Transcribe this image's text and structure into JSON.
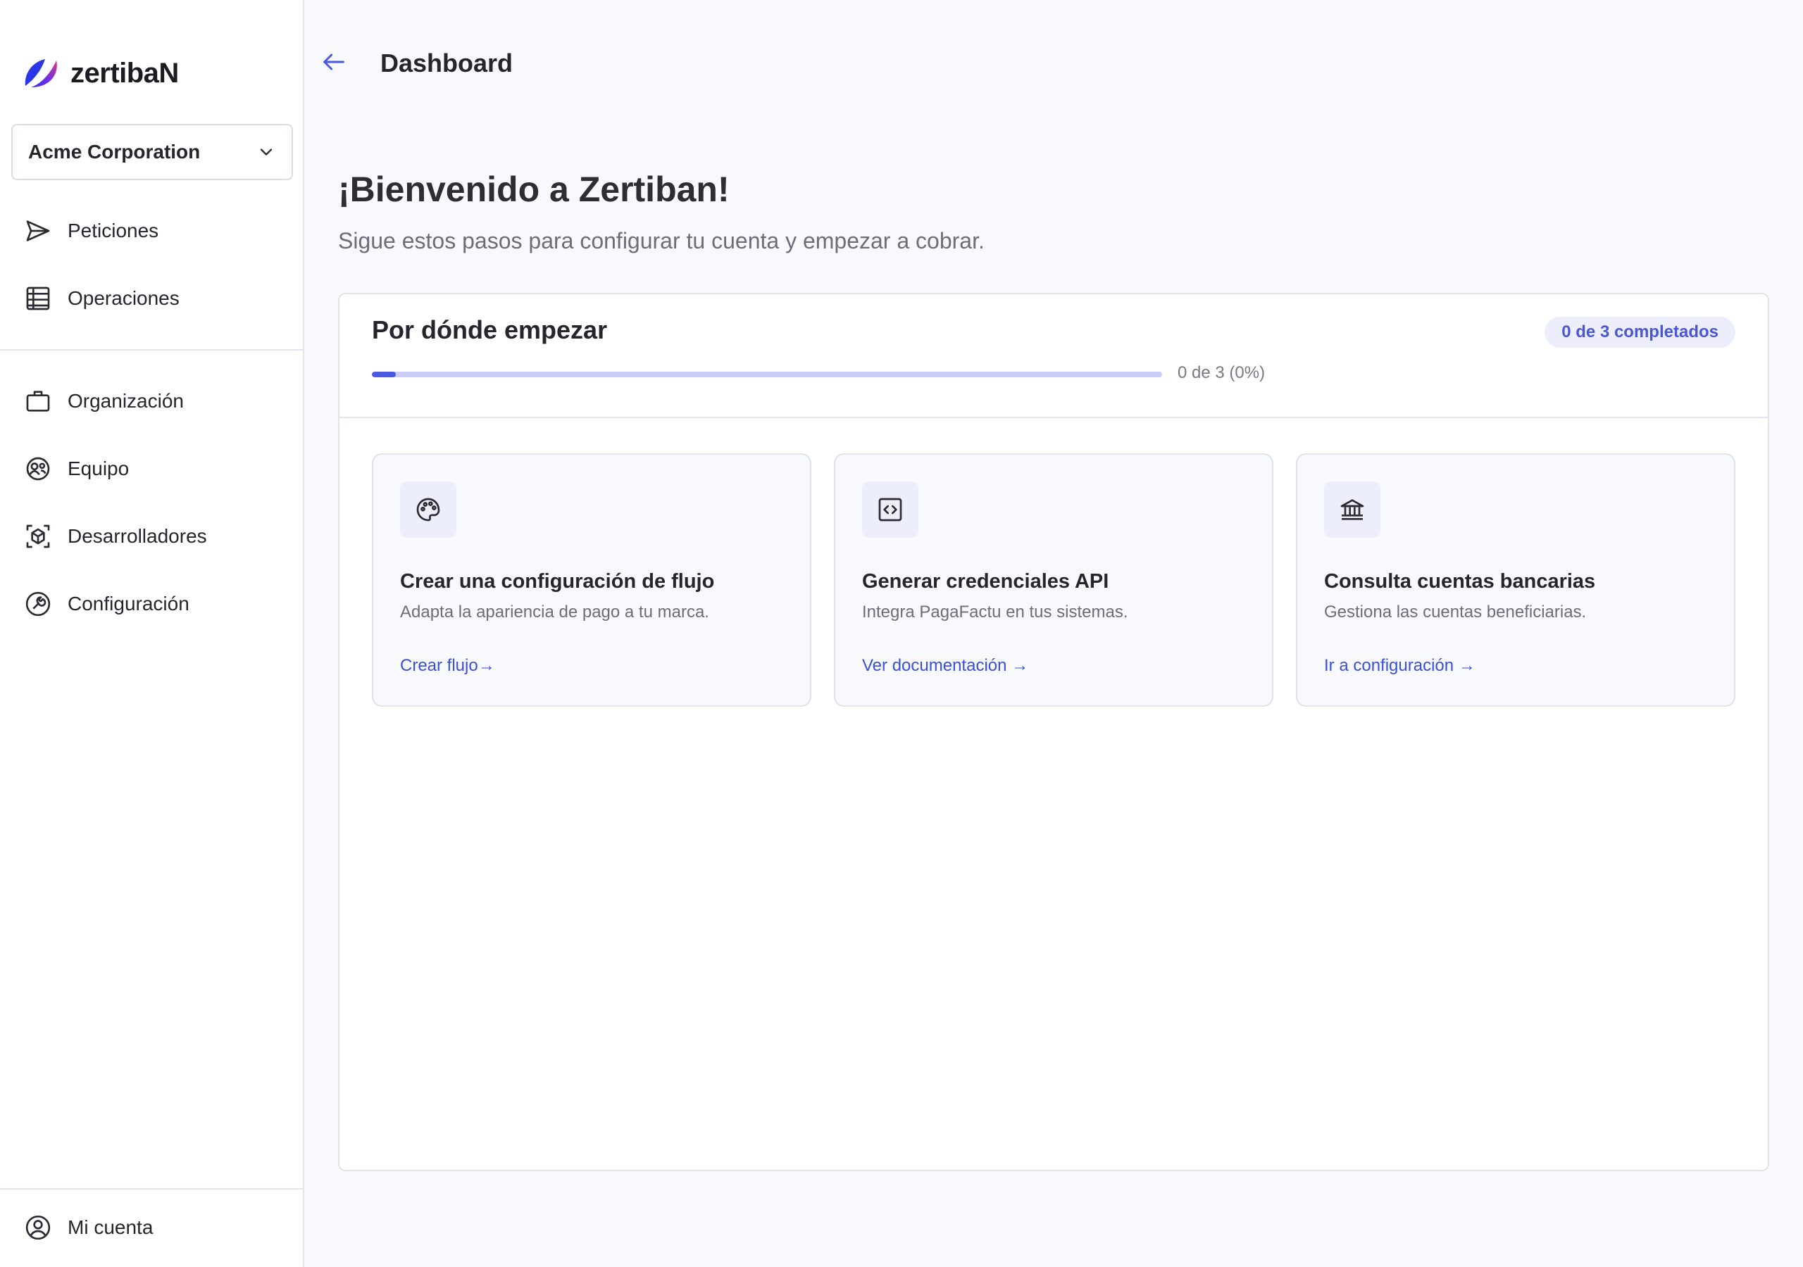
{
  "brand": {
    "name": "zertibaN"
  },
  "org_selector": {
    "value": "Acme Corporation"
  },
  "nav": {
    "primary": [
      {
        "label": "Peticiones",
        "icon": "send-icon"
      },
      {
        "label": "Operaciones",
        "icon": "list-icon"
      }
    ],
    "secondary": [
      {
        "label": "Organización",
        "icon": "briefcase-icon"
      },
      {
        "label": "Equipo",
        "icon": "team-icon"
      },
      {
        "label": "Desarrolladores",
        "icon": "cube-icon"
      },
      {
        "label": "Configuración",
        "icon": "wrench-icon"
      }
    ],
    "account": {
      "label": "Mi cuenta",
      "icon": "user-icon"
    }
  },
  "header": {
    "title": "Dashboard"
  },
  "welcome": {
    "title": "¡Bienvenido a Zertiban!",
    "subtitle": "Sigue estos pasos para configurar tu cuenta y empezar a cobrar."
  },
  "getting_started": {
    "title": "Por dónde empezar",
    "badge": "0 de 3 completados",
    "progress_text": "0 de 3 (0%)",
    "progress_fraction": 0.03,
    "cards": [
      {
        "icon": "palette-icon",
        "title": "Crear una configuración de flujo",
        "description": "Adapta la apariencia de pago a tu marca.",
        "link": "Crear flujo→"
      },
      {
        "icon": "code-icon",
        "title": "Generar credenciales API",
        "description": "Integra PagaFactu en tus sistemas.",
        "link": "Ver documentación →"
      },
      {
        "icon": "bank-icon",
        "title": "Consulta cuentas bancarias",
        "description": "Gestiona las cuentas beneficiarias.",
        "link": "Ir a configuración →"
      }
    ]
  },
  "colors": {
    "accent": "#4b58e0",
    "link": "#3b4fd8",
    "badge_bg": "#eceefd",
    "background": "#f8f9fd"
  }
}
